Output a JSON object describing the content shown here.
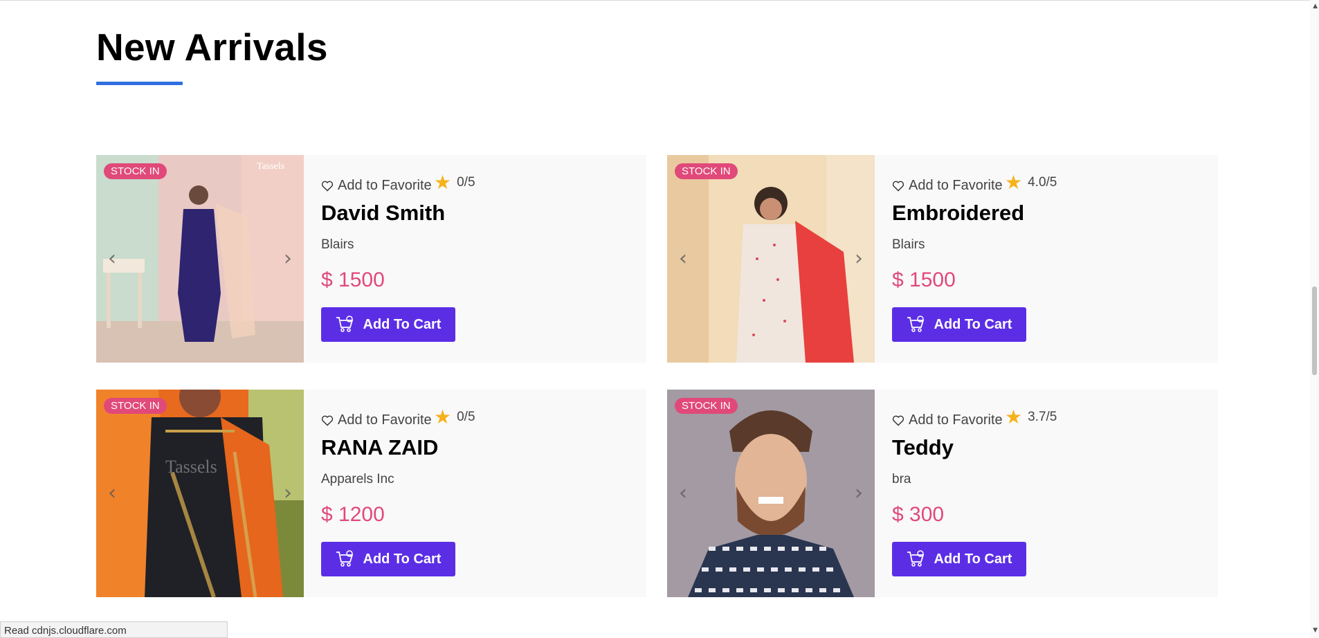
{
  "section": {
    "title": "New Arrivals"
  },
  "products": [
    {
      "badge": "STOCK IN",
      "favorite_label": "Add to Favorite",
      "rating": "0/5",
      "name": "David Smith",
      "brand": "Blairs",
      "price": "$ 1500",
      "cart_label": "Add To Cart"
    },
    {
      "badge": "STOCK IN",
      "favorite_label": "Add to Favorite",
      "rating": "4.0/5",
      "name": "Embroidered",
      "brand": "Blairs",
      "price": "$ 1500",
      "cart_label": "Add To Cart"
    },
    {
      "badge": "STOCK IN",
      "favorite_label": "Add to Favorite",
      "rating": "0/5",
      "name": "RANA ZAID",
      "brand": "Apparels Inc",
      "price": "$ 1200",
      "cart_label": "Add To Cart"
    },
    {
      "badge": "STOCK IN",
      "favorite_label": "Add to Favorite",
      "rating": "3.7/5",
      "name": "Teddy",
      "brand": "bra",
      "price": "$ 300",
      "cart_label": "Add To Cart"
    }
  ],
  "status_bar": {
    "text": "Read cdnjs.cloudflare.com"
  },
  "icons": {
    "favorite": "heart-outline-icon",
    "rating": "star-icon",
    "cart": "cart-icon",
    "prev": "chevron-left-icon",
    "next": "chevron-right-icon"
  },
  "colors": {
    "accent": "#5b2ee6",
    "price": "#e0497a",
    "badge": "#e0497a",
    "underline": "#2f6fe0",
    "star": "#f6b21b"
  }
}
